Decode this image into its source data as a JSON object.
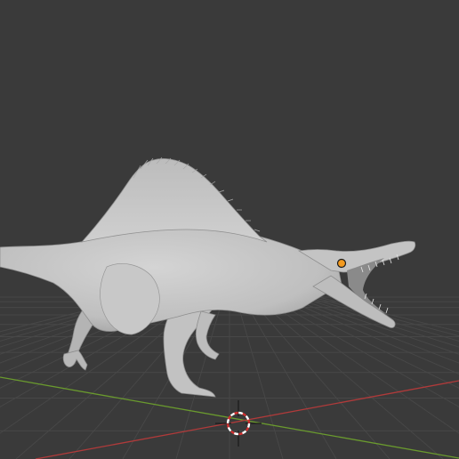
{
  "viewport": {
    "background_color": "#3a3a3a",
    "grid_color": "#444444",
    "x_axis_color": "#b03a3a",
    "y_axis_color": "#6a9a2e",
    "model_color": "#c6c6c6",
    "origin_point_color": "#f39a1f",
    "cursor_icon": "3d-cursor-icon",
    "cursor_colors": [
      "#ffffff",
      "#d03030"
    ]
  }
}
